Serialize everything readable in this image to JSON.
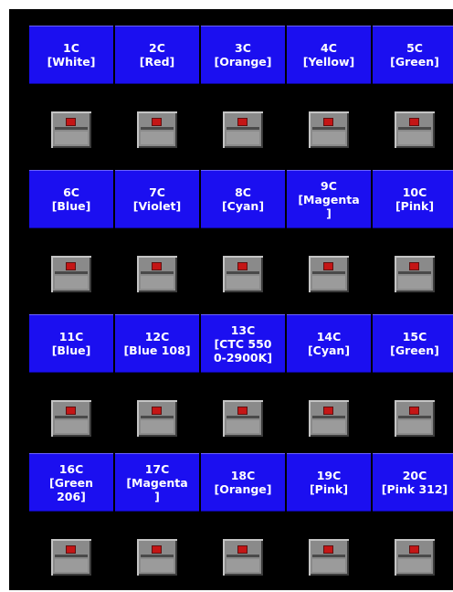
{
  "banks": [
    {
      "buttons": [
        {
          "label": "1C\n[White]"
        },
        {
          "label": "2C\n[Red]"
        },
        {
          "label": "3C\n[Orange]"
        },
        {
          "label": "4C\n[Yellow]"
        },
        {
          "label": "5C\n[Green]"
        }
      ]
    },
    {
      "buttons": [
        {
          "label": "6C\n[Blue]"
        },
        {
          "label": "7C\n[Violet]"
        },
        {
          "label": "8C\n[Cyan]"
        },
        {
          "label": "9C\n[Magenta\n]"
        },
        {
          "label": "10C\n[Pink]"
        }
      ]
    },
    {
      "buttons": [
        {
          "label": "11C\n[Blue]"
        },
        {
          "label": "12C\n[Blue 108]"
        },
        {
          "label": "13C\n[CTC 550\n0-2900K]"
        },
        {
          "label": "14C\n[Cyan]"
        },
        {
          "label": "15C\n[Green]"
        }
      ]
    },
    {
      "buttons": [
        {
          "label": "16C\n[Green\n206]"
        },
        {
          "label": "17C\n[Magenta\n]"
        },
        {
          "label": "18C\n[Orange]"
        },
        {
          "label": "19C\n[Pink]"
        },
        {
          "label": "20C\n[Pink 312]"
        }
      ]
    }
  ],
  "colors": {
    "background": "#000000",
    "button": "#1b0ff0",
    "button_text": "#ffffff",
    "flag_gray": "#8a8a8a",
    "indicator_red": "#c41616"
  },
  "icons": {
    "flag": "flag-toggle-icon",
    "indicator": "red-indicator-icon"
  }
}
